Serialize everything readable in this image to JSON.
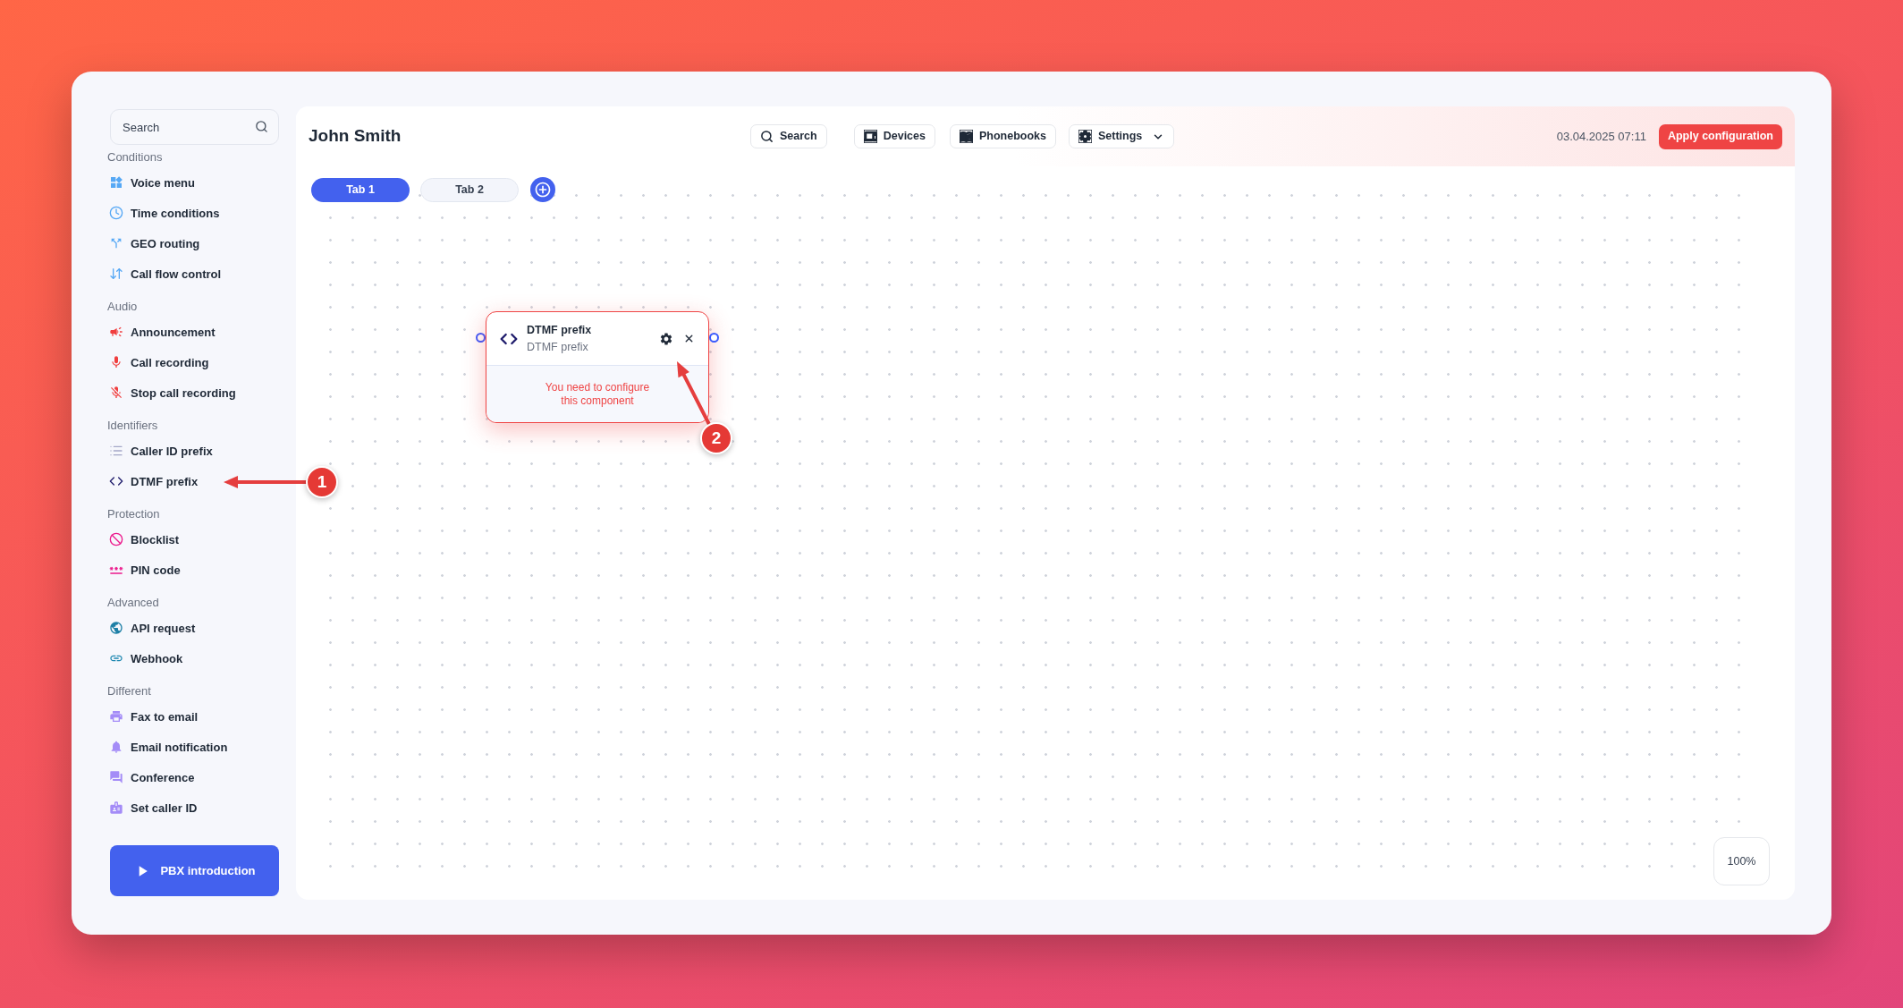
{
  "sidebar": {
    "search": {
      "placeholder": "Search"
    },
    "sections": [
      {
        "heading": "Conditions",
        "items": [
          {
            "label": "Voice menu"
          },
          {
            "label": "Time conditions"
          },
          {
            "label": "GEO routing"
          },
          {
            "label": "Call flow control"
          }
        ]
      },
      {
        "heading": "Audio",
        "items": [
          {
            "label": "Announcement"
          },
          {
            "label": "Call recording"
          },
          {
            "label": "Stop call recording"
          }
        ]
      },
      {
        "heading": "Identifiers",
        "items": [
          {
            "label": "Caller ID prefix"
          },
          {
            "label": "DTMF prefix"
          }
        ]
      },
      {
        "heading": "Protection",
        "items": [
          {
            "label": "Blocklist"
          },
          {
            "label": "PIN code"
          }
        ]
      },
      {
        "heading": "Advanced",
        "items": [
          {
            "label": "API request"
          },
          {
            "label": "Webhook"
          }
        ]
      },
      {
        "heading": "Different",
        "items": [
          {
            "label": "Fax to email"
          },
          {
            "label": "Email notification"
          },
          {
            "label": "Conference"
          },
          {
            "label": "Set caller ID"
          }
        ]
      }
    ],
    "intro_button": {
      "label": "PBX introduction"
    }
  },
  "header": {
    "title": "John Smith",
    "buttons": [
      {
        "label": "Search",
        "dropdown": false
      },
      {
        "label": "Devices",
        "dropdown": false
      },
      {
        "label": "Phonebooks",
        "dropdown": false
      },
      {
        "label": "Settings",
        "dropdown": true
      }
    ],
    "timestamp": "03.04.2025 07:11",
    "apply_button": {
      "label": "Apply configuration"
    }
  },
  "tabs": [
    {
      "label": "Tab 1",
      "selected": true
    },
    {
      "label": "Tab 2",
      "selected": false
    }
  ],
  "node": {
    "title": "DTMF prefix",
    "subtitle": "DTMF prefix",
    "invalid": true,
    "warning": "You need to configure this component"
  },
  "zoom": {
    "label": "100%"
  },
  "annotations": [
    {
      "number": "1"
    },
    {
      "number": "2"
    }
  ]
}
